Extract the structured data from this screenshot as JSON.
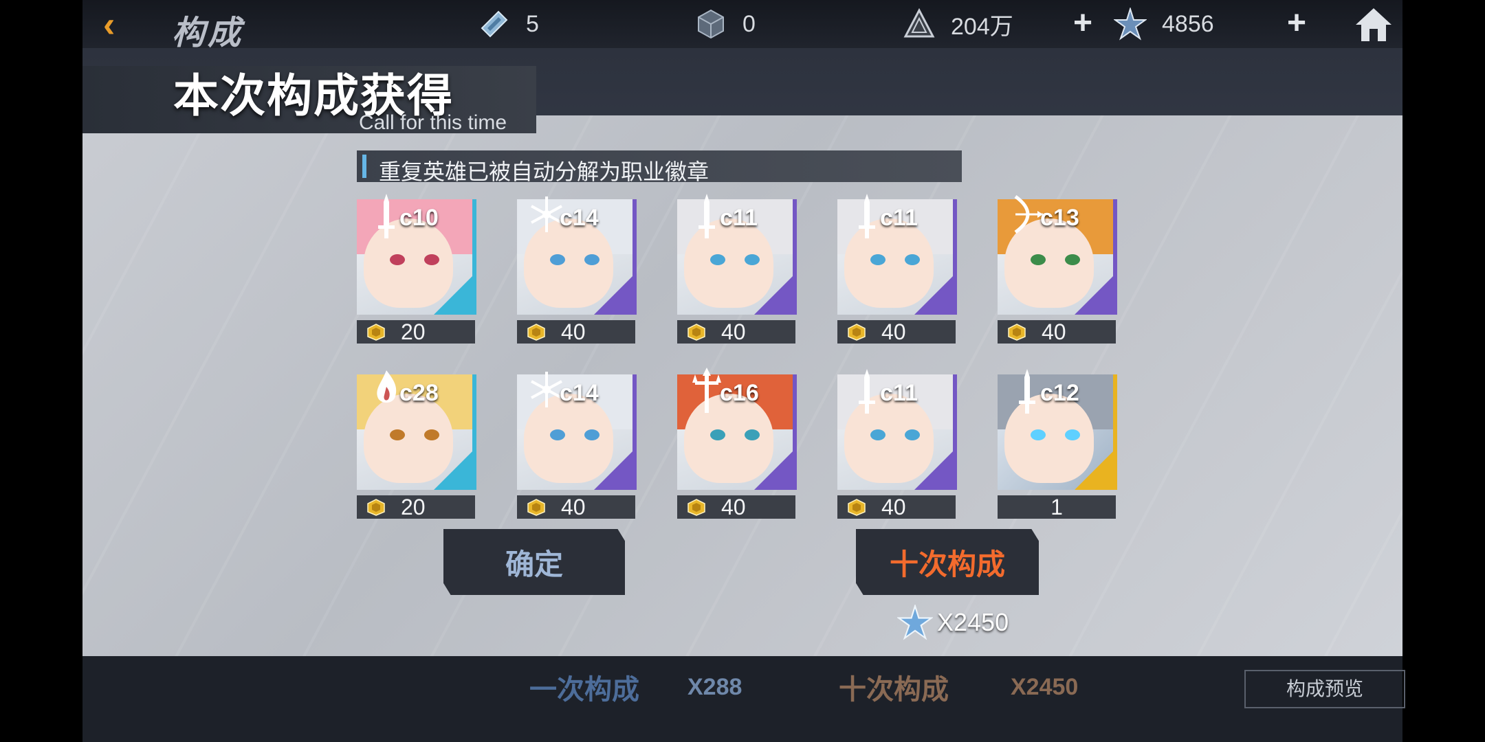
{
  "topbar": {
    "title": "构成",
    "resources": [
      {
        "icon": "ticket-icon",
        "value": "5"
      },
      {
        "icon": "cube-icon",
        "value": "0"
      },
      {
        "icon": "triangle-coin-icon",
        "value": "204万"
      },
      {
        "icon": "star-crystal-icon",
        "value": "4856"
      }
    ],
    "plus_label": "+"
  },
  "bottombar": {
    "single_label": "一次构成",
    "single_price": "X288",
    "ten_label": "十次构成",
    "ten_price": "X2450",
    "preview_label": "构成预览"
  },
  "dialog": {
    "title": "本次构成获得",
    "subtitle": "Call for this time",
    "notice": "重复英雄已被自动分解为职业徽章",
    "confirm_label": "确定",
    "ten_pull_label": "十次构成",
    "ten_pull_price": "X2450"
  },
  "heroes": [
    {
      "cost": "c10",
      "amount": "20",
      "class_icon": "sword-icon",
      "rarity": "blue",
      "hair": "#f3a6b8",
      "eye": "#c0405c"
    },
    {
      "cost": "c14",
      "amount": "40",
      "class_icon": "snowflake-icon",
      "rarity": "purple",
      "hair": "#e4e8ee",
      "eye": "#4f9ed6"
    },
    {
      "cost": "c11",
      "amount": "40",
      "class_icon": "sword-icon",
      "rarity": "purple",
      "hair": "#e6e6ea",
      "eye": "#4aa6d6"
    },
    {
      "cost": "c11",
      "amount": "40",
      "class_icon": "sword-icon",
      "rarity": "purple",
      "hair": "#e6e6ea",
      "eye": "#4aa6d6"
    },
    {
      "cost": "c13",
      "amount": "40",
      "class_icon": "bow-icon",
      "rarity": "purple",
      "hair": "#e89a3a",
      "eye": "#3c8c4a"
    },
    {
      "cost": "c28",
      "amount": "20",
      "class_icon": "flame-icon",
      "rarity": "blue",
      "hair": "#f2d27a",
      "eye": "#c07a2a"
    },
    {
      "cost": "c14",
      "amount": "40",
      "class_icon": "snowflake-icon",
      "rarity": "purple",
      "hair": "#e4e8ee",
      "eye": "#4f9ed6"
    },
    {
      "cost": "c16",
      "amount": "40",
      "class_icon": "trident-icon",
      "rarity": "purple",
      "hair": "#e0623a",
      "eye": "#3aa0b8"
    },
    {
      "cost": "c11",
      "amount": "40",
      "class_icon": "sword-icon",
      "rarity": "purple",
      "hair": "#e6e6ea",
      "eye": "#4aa6d6"
    },
    {
      "cost": "c12",
      "amount": "1",
      "class_icon": "sword-icon",
      "rarity": "gold",
      "hair": "#9aa3b0",
      "eye": "#5fd0ff"
    }
  ],
  "colors": {
    "blue": "#3ab6d8",
    "purple": "#7457c4",
    "gold": "#e9b320",
    "accent_orange": "#f36b2d"
  }
}
